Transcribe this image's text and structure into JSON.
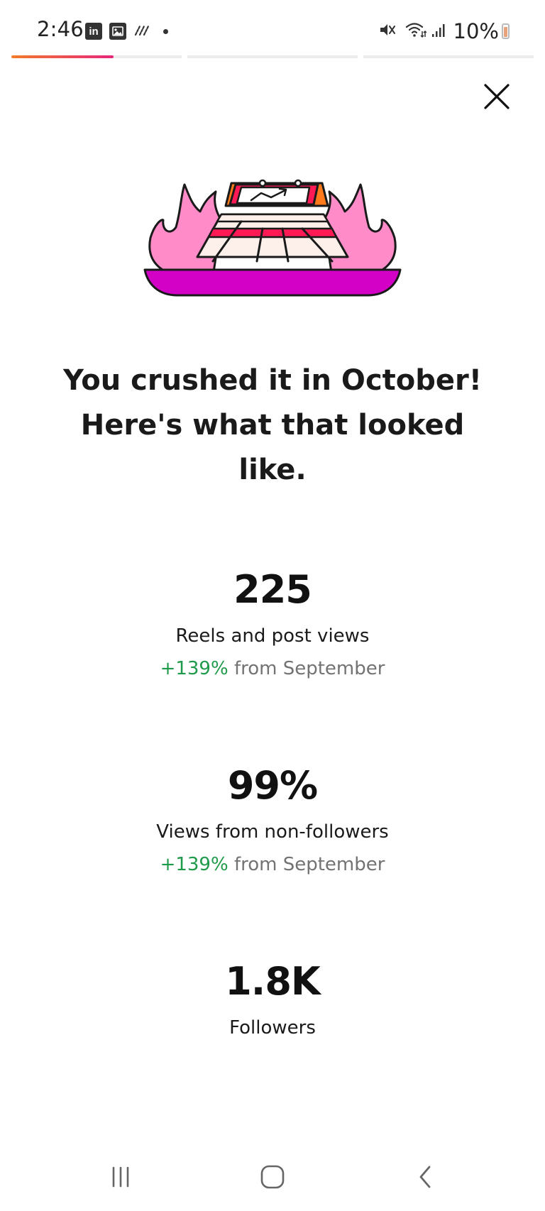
{
  "status_bar": {
    "time": "2:46",
    "left_icons": [
      "linkedin-icon",
      "gallery-icon",
      "activity-icon",
      "notification-dot-icon"
    ],
    "right_icons": [
      "mute-icon",
      "wifi-icon",
      "signal-icon",
      "battery-icon"
    ],
    "battery": "10%"
  },
  "story": {
    "segments": 3,
    "current_segment": 1,
    "current_progress": 0.6
  },
  "headline": "You crushed it in October! Here's what that looked like.",
  "stats": [
    {
      "value": "225",
      "label": "Reels and post views",
      "change_pct": "+139%",
      "change_suffix": "from September"
    },
    {
      "value": "99%",
      "label": "Views from non-followers",
      "change_pct": "+139%",
      "change_suffix": "from September"
    },
    {
      "value": "1.8K",
      "label": "Followers"
    }
  ],
  "colors": {
    "positive_change": "#1f9a4a",
    "flame_pink": "#ff8cc8",
    "base_magenta": "#d300c5",
    "accent_red": "#ff1a55",
    "accent_orange": "#ff7a1a"
  },
  "nav_bar": {
    "icons": [
      "recent-apps-icon",
      "home-icon",
      "back-icon"
    ]
  }
}
